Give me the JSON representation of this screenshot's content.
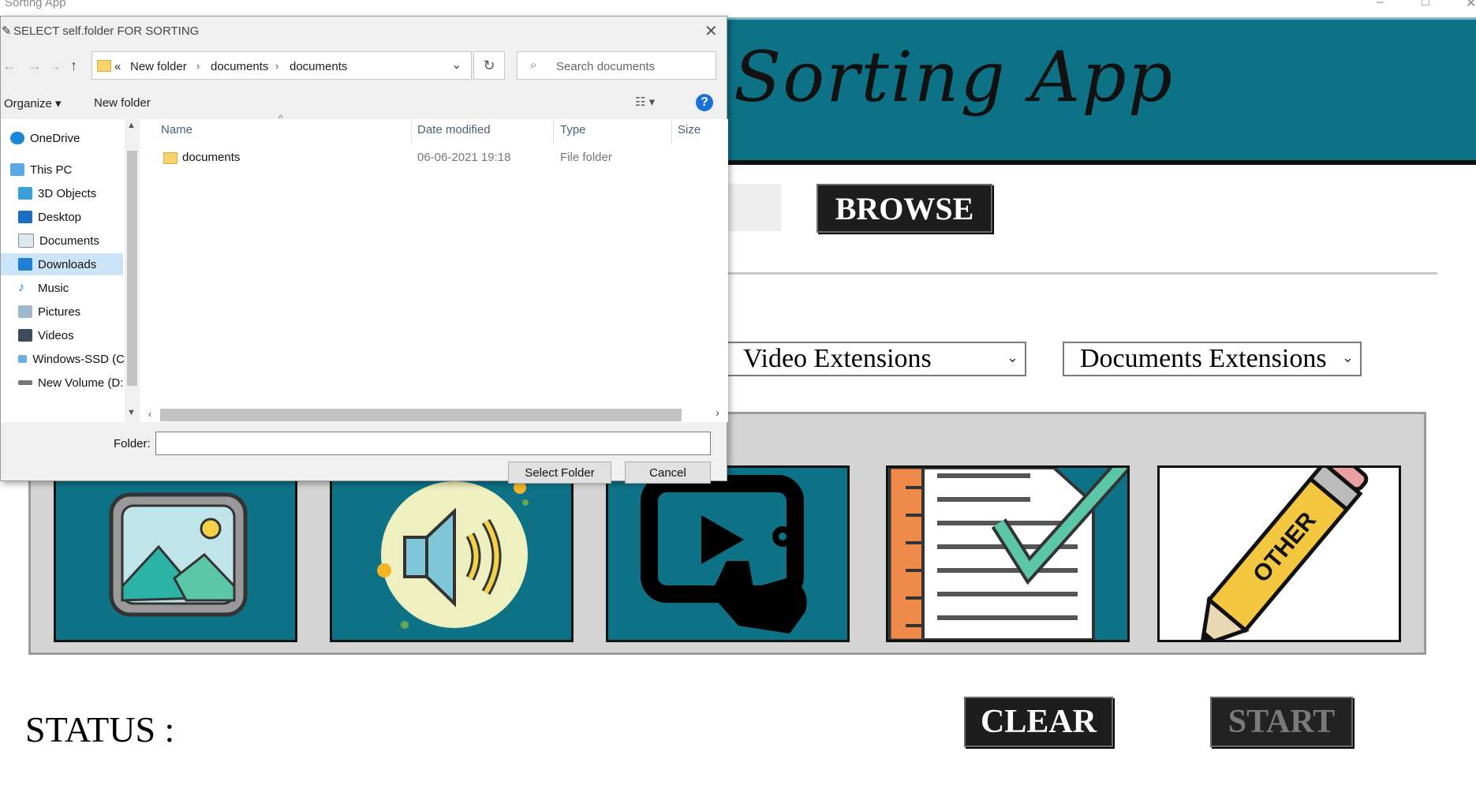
{
  "app": {
    "window_title": "Sorting App",
    "banner_title": "Sorting App",
    "browse_label": "BROWSE",
    "video_ext": "Video Extensions",
    "docs_ext": "Documents Extensions",
    "status_label": "STATUS :",
    "clear_label": "CLEAR",
    "start_label": "START",
    "other_label": "OTHER",
    "colors": {
      "teal": "#0d7286",
      "dark_button": "#1d1d1d",
      "panel": "#d4d4d4"
    }
  },
  "dialog": {
    "title": "SELECT self.folder FOR SORTING",
    "breadcrumb": [
      "«",
      "New folder",
      "documents",
      "documents"
    ],
    "search_placeholder": "Search documents",
    "organize_label": "Organize ▾",
    "new_folder_label": "New folder",
    "nav_items": [
      {
        "label": "OneDrive",
        "icon": "cloud-icon"
      },
      {
        "label": "This PC",
        "icon": "computer-icon"
      },
      {
        "label": "3D Objects",
        "icon": "cube-icon"
      },
      {
        "label": "Desktop",
        "icon": "desktop-icon"
      },
      {
        "label": "Documents",
        "icon": "document-icon"
      },
      {
        "label": "Downloads",
        "icon": "download-icon",
        "selected": true
      },
      {
        "label": "Music",
        "icon": "music-icon"
      },
      {
        "label": "Pictures",
        "icon": "pictures-icon"
      },
      {
        "label": "Videos",
        "icon": "video-icon"
      },
      {
        "label": "Windows-SSD (C",
        "icon": "drive-icon"
      },
      {
        "label": "New Volume (D:",
        "icon": "drive-icon"
      }
    ],
    "columns": [
      "Name",
      "Date modified",
      "Type",
      "Size"
    ],
    "rows": [
      {
        "name": "documents",
        "date": "06-06-2021 19:18",
        "type": "File folder",
        "size": ""
      }
    ],
    "folder_label": "Folder:",
    "folder_value": "",
    "select_button": "Select Folder",
    "cancel_button": "Cancel"
  }
}
